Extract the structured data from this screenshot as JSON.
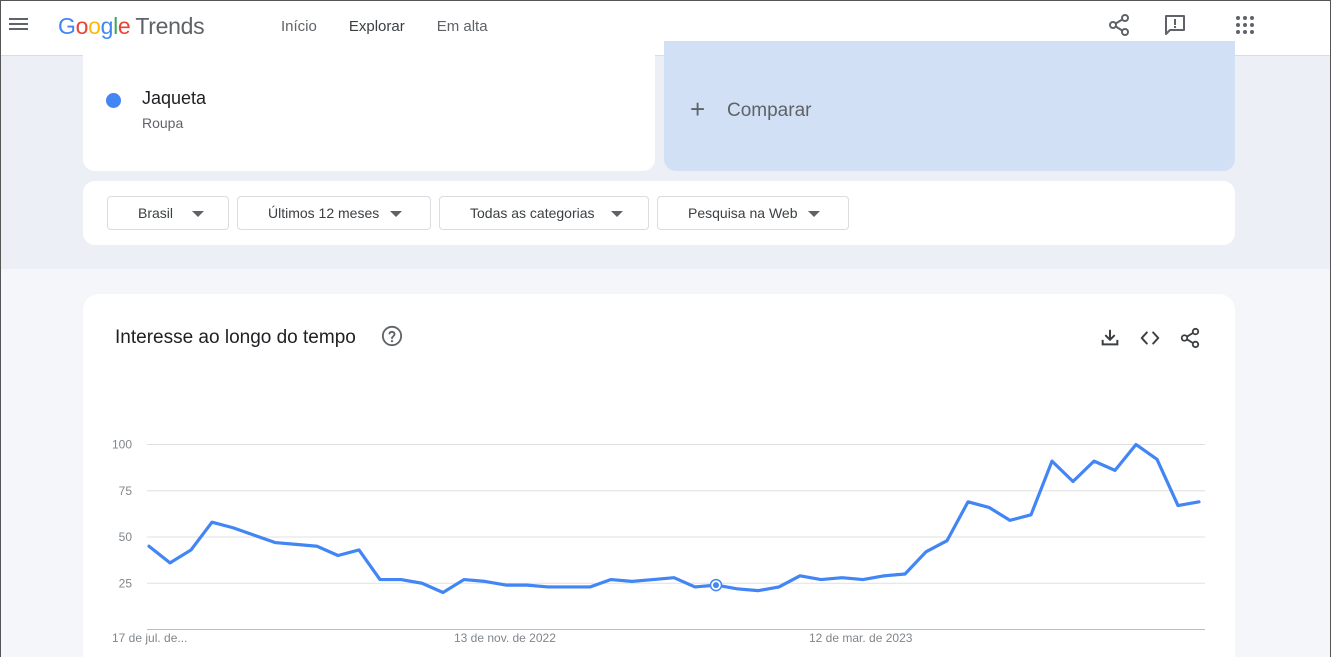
{
  "header": {
    "logo_google": [
      "G",
      "o",
      "o",
      "g",
      "l",
      "e"
    ],
    "logo_trends": "Trends",
    "nav": [
      {
        "label": "Início",
        "active": false
      },
      {
        "label": "Explorar",
        "active": true
      },
      {
        "label": "Em alta",
        "active": false
      }
    ],
    "icons": [
      "share-icon",
      "feedback-icon",
      "apps-grid-icon"
    ]
  },
  "term": {
    "name": "Jaqueta",
    "category": "Roupa",
    "color": "#4285f4"
  },
  "compare": {
    "label": "Comparar",
    "icon": "plus-icon"
  },
  "filters": [
    {
      "label": "Brasil"
    },
    {
      "label": "Últimos 12 meses"
    },
    {
      "label": "Todas as categorias"
    },
    {
      "label": "Pesquisa na Web"
    }
  ],
  "chart_card": {
    "title": "Interesse ao longo do tempo",
    "icons": [
      "help-icon",
      "download-icon",
      "embed-code-icon",
      "share-icon"
    ]
  },
  "chart_data": {
    "type": "line",
    "title": "Interesse ao longo do tempo",
    "ylim": [
      0,
      100
    ],
    "yticks": [
      "100",
      "75",
      "50",
      "25"
    ],
    "ytick_values": [
      100,
      75,
      50,
      25
    ],
    "xtick_labels": [
      "17 de jul. de...",
      "13 de nov. de 2022",
      "12 de mar. de 2023"
    ],
    "xtick_indices": [
      0,
      17,
      34
    ],
    "highlight_index": 27,
    "series": [
      {
        "color": "#4285f4",
        "values": [
          45,
          36,
          43,
          58,
          55,
          51,
          47,
          46,
          45,
          40,
          43,
          27,
          27,
          25,
          20,
          27,
          26,
          24,
          24,
          23,
          23,
          23,
          27,
          26,
          27,
          28,
          23,
          24,
          22,
          21,
          23,
          29,
          27,
          28,
          27,
          29,
          30,
          42,
          48,
          69,
          66,
          59,
          62,
          91,
          80,
          91,
          86,
          100,
          92,
          67,
          69
        ]
      }
    ]
  }
}
